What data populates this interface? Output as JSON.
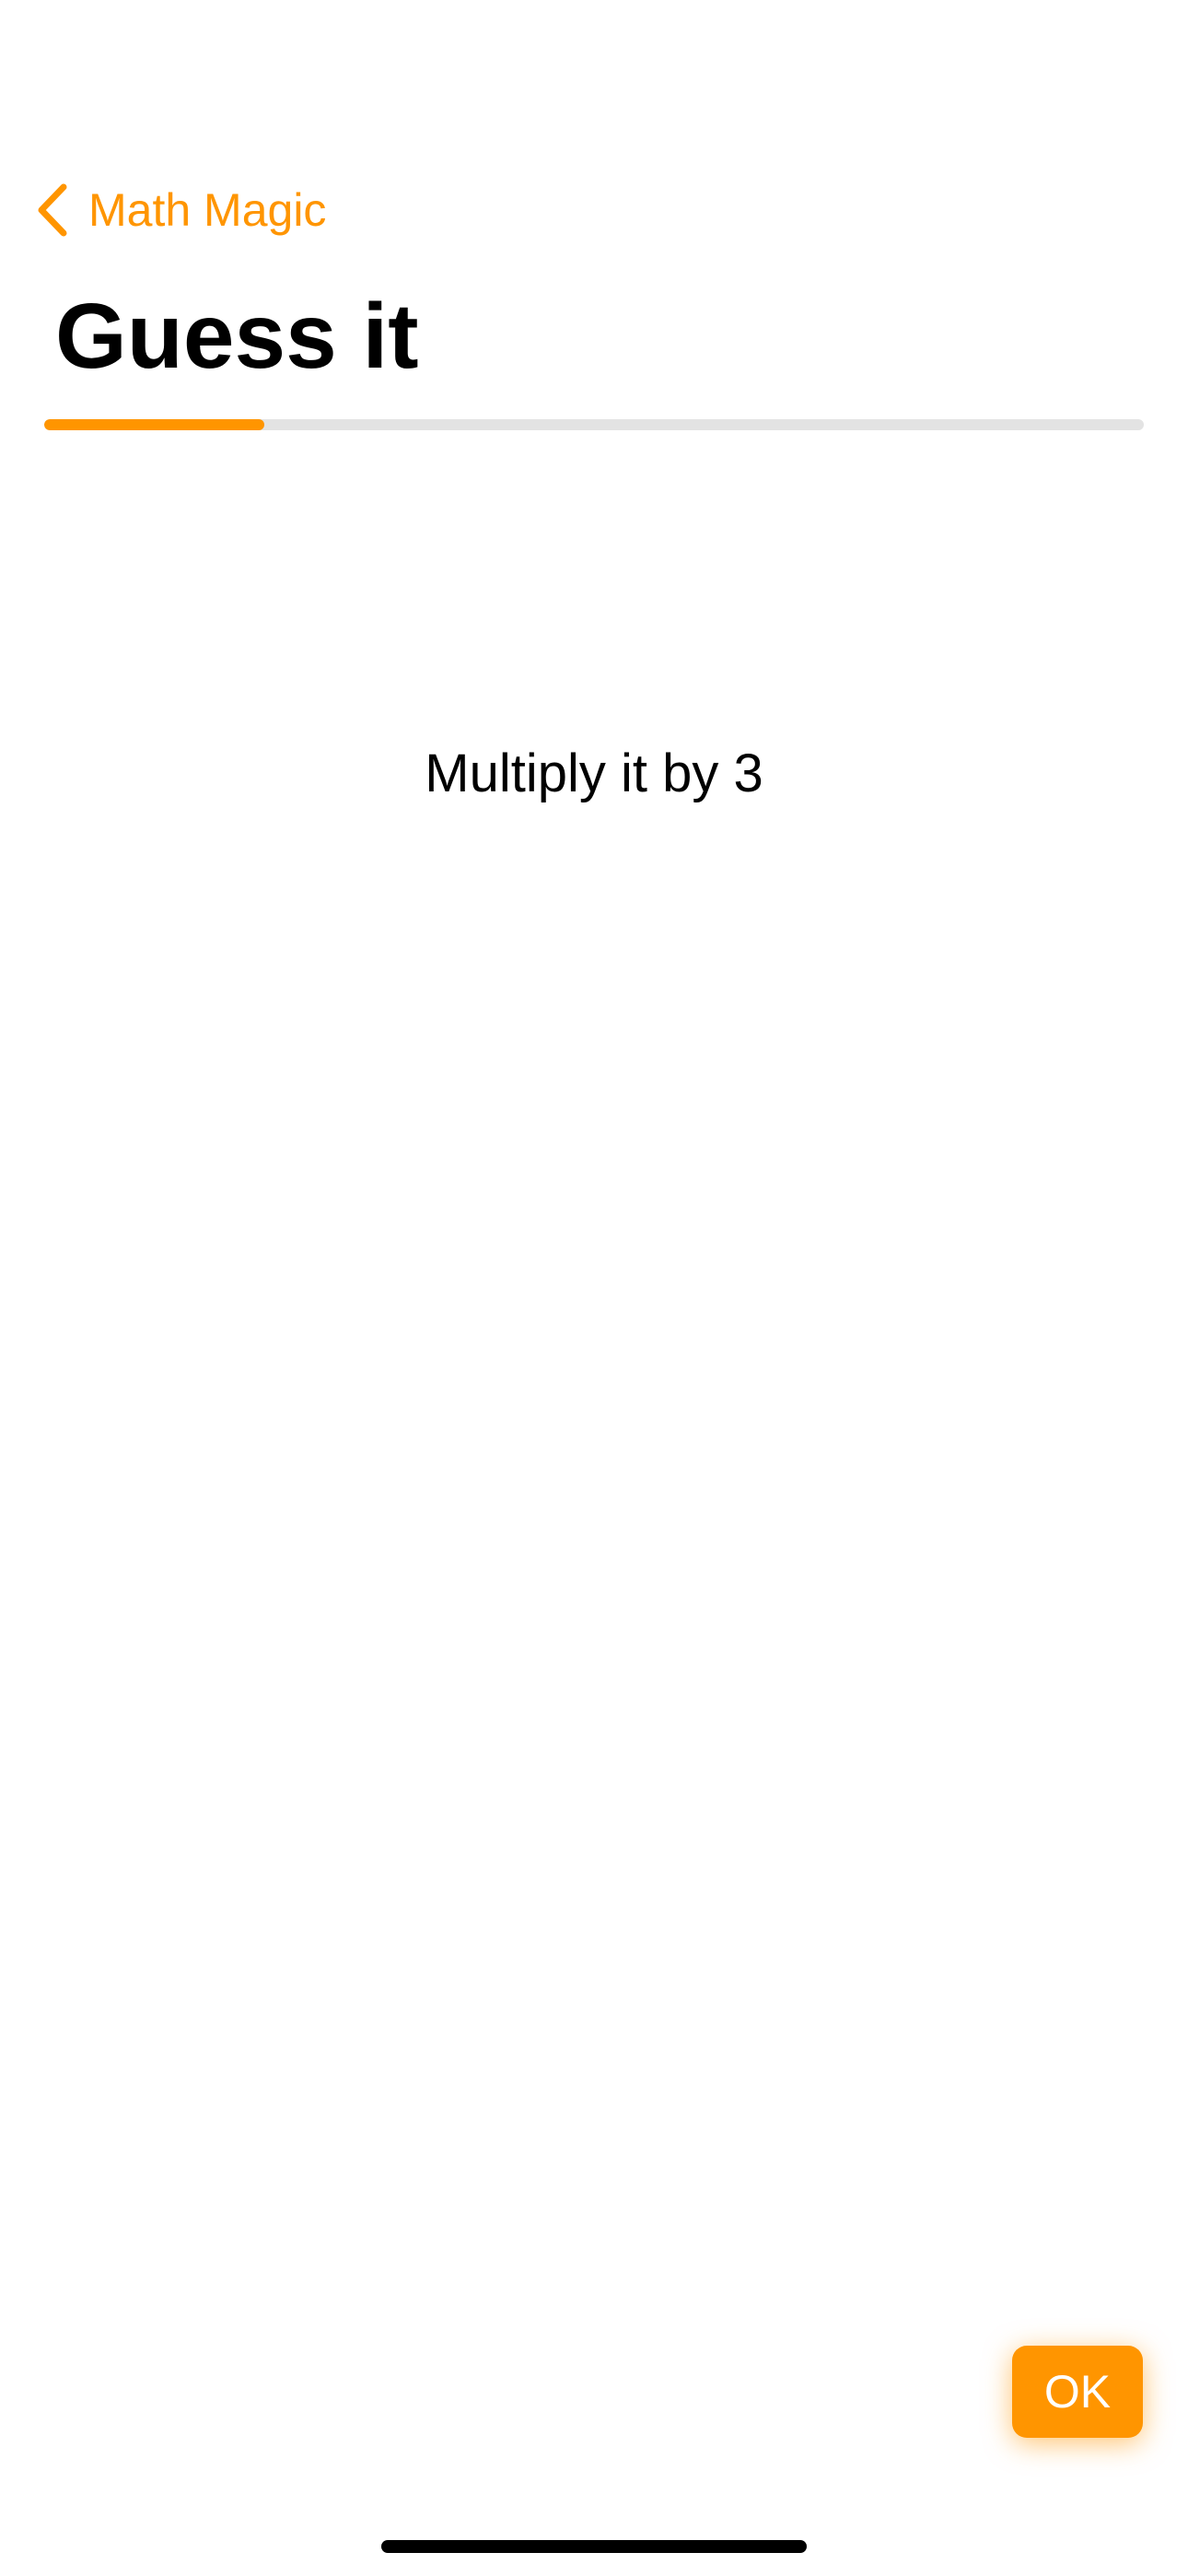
{
  "nav": {
    "back_label": "Math Magic",
    "back_icon": "chevron-left-icon"
  },
  "page": {
    "title": "Guess it"
  },
  "progress": {
    "value": 0.2
  },
  "content": {
    "instruction": "Multiply it by 3"
  },
  "actions": {
    "ok_label": "OK"
  },
  "colors": {
    "accent": "#FF9500",
    "track": "#E3E3E3",
    "text": "#000000",
    "background": "#FFFFFF"
  }
}
